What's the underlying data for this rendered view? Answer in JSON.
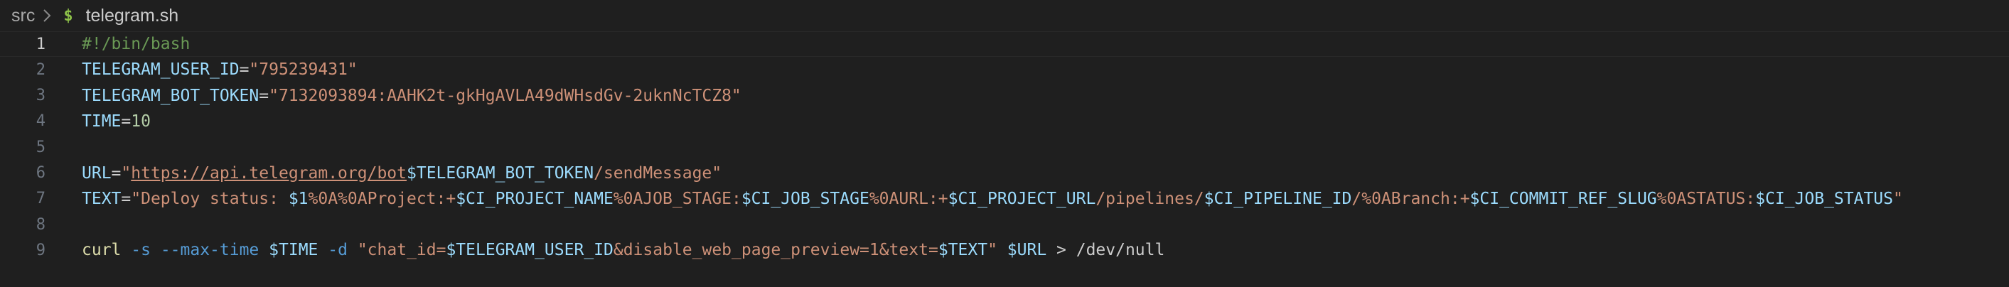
{
  "breadcrumb": {
    "folder": "src",
    "file_icon": "$",
    "file": "telegram.sh"
  },
  "colors": {
    "background": "#1f1f1f",
    "comment": "#6a9955",
    "variable": "#9cdcfe",
    "string": "#ce9178",
    "number": "#b5cea8",
    "function": "#dcdcaa",
    "escape": "#d7ba7d",
    "flag": "#569cd6"
  },
  "lines": [
    {
      "n": "1",
      "tokens": [
        [
          "c",
          "#!/bin/bash"
        ]
      ]
    },
    {
      "n": "2",
      "tokens": [
        [
          "v",
          "TELEGRAM_USER_ID"
        ],
        [
          "p",
          "="
        ],
        [
          "s",
          "\"795239431\""
        ]
      ]
    },
    {
      "n": "3",
      "tokens": [
        [
          "v",
          "TELEGRAM_BOT_TOKEN"
        ],
        [
          "p",
          "="
        ],
        [
          "s",
          "\"7132093894:AAHK2t-gkHgAVLA49dWHsdGv-2uknNcTCZ8\""
        ]
      ]
    },
    {
      "n": "4",
      "tokens": [
        [
          "v",
          "TIME"
        ],
        [
          "p",
          "="
        ],
        [
          "num",
          "10"
        ]
      ]
    },
    {
      "n": "5",
      "tokens": []
    },
    {
      "n": "6",
      "tokens": [
        [
          "v",
          "URL"
        ],
        [
          "p",
          "="
        ],
        [
          "s",
          "\""
        ],
        [
          "link",
          "https://api.telegram.org/bot"
        ],
        [
          "v",
          "$TELEGRAM_BOT_TOKEN"
        ],
        [
          "s",
          "/sendMessage\""
        ]
      ]
    },
    {
      "n": "7",
      "tokens": [
        [
          "v",
          "TEXT"
        ],
        [
          "p",
          "="
        ],
        [
          "s",
          "\"Deploy status: "
        ],
        [
          "v",
          "$1"
        ],
        [
          "s",
          "%0A%0AProject:+"
        ],
        [
          "v",
          "$CI_PROJECT_NAME"
        ],
        [
          "s",
          "%0AJOB_STAGE:"
        ],
        [
          "v",
          "$CI_JOB_STAGE"
        ],
        [
          "s",
          "%0AURL:+"
        ],
        [
          "v",
          "$CI_PROJECT_URL"
        ],
        [
          "s",
          "/pipelines/"
        ],
        [
          "v",
          "$CI_PIPELINE_ID"
        ],
        [
          "s",
          "/%0ABranch:+"
        ],
        [
          "v",
          "$CI_COMMIT_REF_SLUG"
        ],
        [
          "s",
          "%0ASTATUS:"
        ],
        [
          "v",
          "$CI_JOB_STATUS"
        ],
        [
          "s",
          "\""
        ]
      ]
    },
    {
      "n": "8",
      "tokens": []
    },
    {
      "n": "9",
      "tokens": [
        [
          "fn",
          "curl"
        ],
        [
          "p",
          " "
        ],
        [
          "flag",
          "-s"
        ],
        [
          "p",
          " "
        ],
        [
          "flag",
          "--max-time"
        ],
        [
          "p",
          " "
        ],
        [
          "v",
          "$TIME"
        ],
        [
          "p",
          " "
        ],
        [
          "flag",
          "-d"
        ],
        [
          "p",
          " "
        ],
        [
          "s",
          "\"chat_id="
        ],
        [
          "v",
          "$TELEGRAM_USER_ID"
        ],
        [
          "s",
          "&disable_web_page_preview=1&text="
        ],
        [
          "v",
          "$TEXT"
        ],
        [
          "s",
          "\""
        ],
        [
          "p",
          " "
        ],
        [
          "v",
          "$URL"
        ],
        [
          "p",
          " > /dev/null"
        ]
      ]
    }
  ]
}
